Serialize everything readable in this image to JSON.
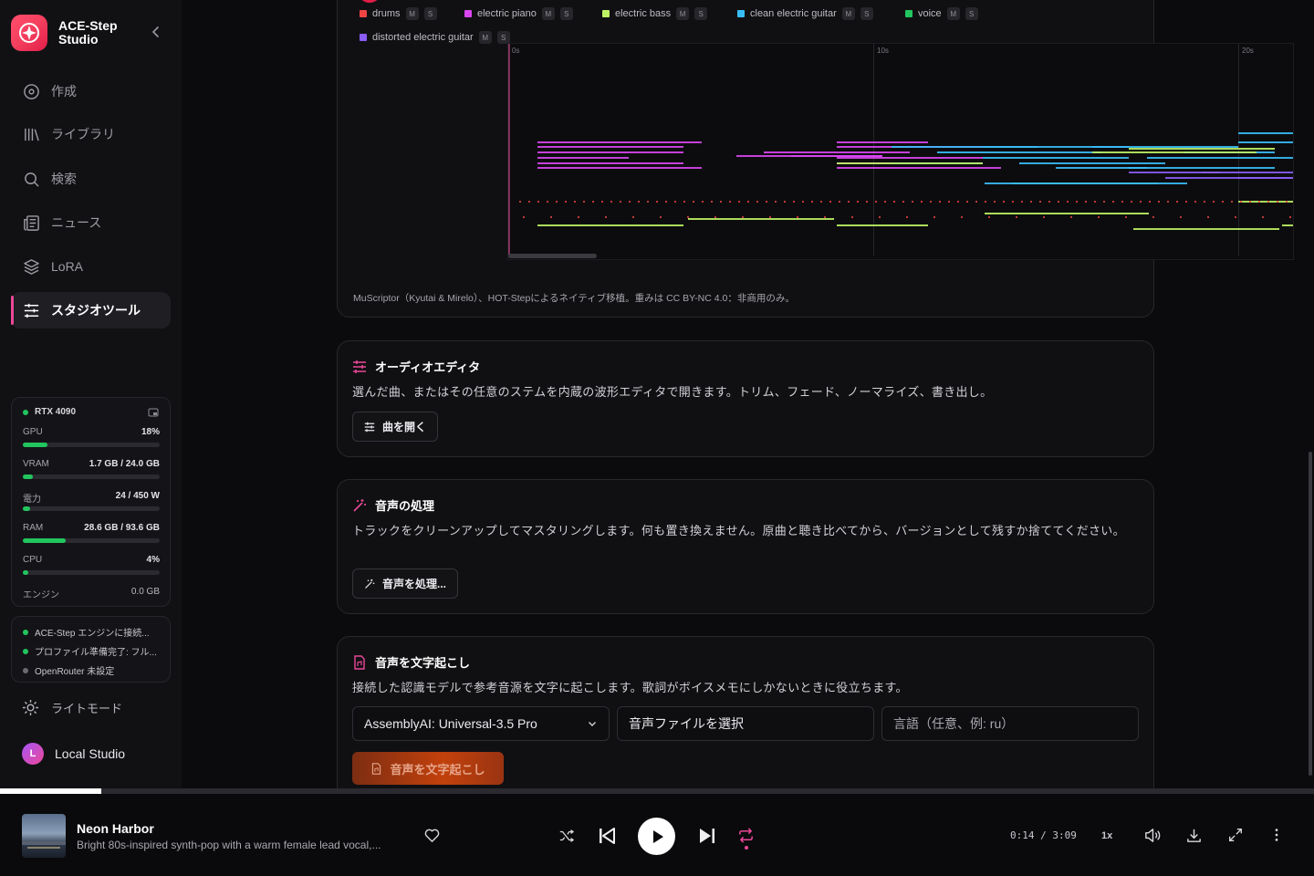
{
  "brand": {
    "name": "ACE-Step Studio"
  },
  "nav": [
    {
      "label": "作成",
      "icon": "disc-icon"
    },
    {
      "label": "ライブラリ",
      "icon": "library-icon"
    },
    {
      "label": "検索",
      "icon": "search-icon"
    },
    {
      "label": "ニュース",
      "icon": "newspaper-icon"
    },
    {
      "label": "LoRA",
      "icon": "layers-icon"
    },
    {
      "label": "スタジオツール",
      "icon": "sliders-icon",
      "active": true
    }
  ],
  "system": {
    "gpu_name": "RTX 4090",
    "rows": [
      {
        "label": "GPU",
        "value": "18%",
        "level": 0.18
      },
      {
        "label": "VRAM",
        "value": "1.7 GB / 24.0 GB",
        "level": 0.07
      },
      {
        "label": "電力",
        "value": "24 / 450 W",
        "level": 0.05
      },
      {
        "label": "RAM",
        "value": "28.6 GB / 93.6 GB",
        "level": 0.31
      },
      {
        "label": "CPU",
        "value": "4%",
        "level": 0.04
      }
    ],
    "engine_label": "エンジン",
    "engine_value": "0.0 GB"
  },
  "status": [
    {
      "text": "ACE-Step エンジンに接続...",
      "state": "ok"
    },
    {
      "text": "プロファイル準備完了: フル...",
      "state": "ok"
    },
    {
      "text": "OpenRouter 未設定",
      "state": "off"
    }
  ],
  "theme_label": "ライトモード",
  "user": {
    "initial": "L",
    "name": "Local Studio"
  },
  "midi": {
    "tracks": [
      {
        "name": "drums",
        "color": "#ef4444"
      },
      {
        "name": "electric piano",
        "color": "#d946ef"
      },
      {
        "name": "electric bass",
        "color": "#bef264"
      },
      {
        "name": "clean electric guitar",
        "color": "#38bdf8"
      },
      {
        "name": "voice",
        "color": "#22c55e"
      },
      {
        "name": "distorted electric guitar",
        "color": "#8b5cf6"
      }
    ],
    "mute_label": "M",
    "solo_label": "S",
    "time_labels": [
      "0s",
      "10s",
      "20s"
    ],
    "credit": "MuScriptor（Kyutai & Mirelo）、HOT-Stepによるネイティブ移植。重みは CC BY-NC 4.0：非商用のみ。"
  },
  "editor": {
    "title": "オーディオエディタ",
    "desc": "選んだ曲、またはその任意のステムを内蔵の波形エディタで開きます。トリム、フェード、ノーマライズ、書き出し。",
    "button": "曲を開く"
  },
  "process": {
    "title": "音声の処理",
    "desc": "トラックをクリーンアップしてマスタリングします。何も置き換えません。原曲と聴き比べてから、バージョンとして残すか捨ててください。",
    "button": "音声を処理..."
  },
  "transcribe": {
    "title": "音声を文字起こし",
    "desc": "接続した認識モデルで参考音源を文字に起こします。歌詞がボイスメモにしかないときに役立ちます。",
    "model": "AssemblyAI: Universal-3.5 Pro",
    "file": "音声ファイルを選択",
    "language_placeholder": "言語（任意、例: ru）",
    "button": "音声を文字起こし"
  },
  "player": {
    "title": "Neon Harbor",
    "subtitle": "Bright 80s-inspired synth-pop with a warm female lead vocal,...",
    "time": "0:14 / 3:09",
    "speed": "1x",
    "progress": 0.077
  }
}
